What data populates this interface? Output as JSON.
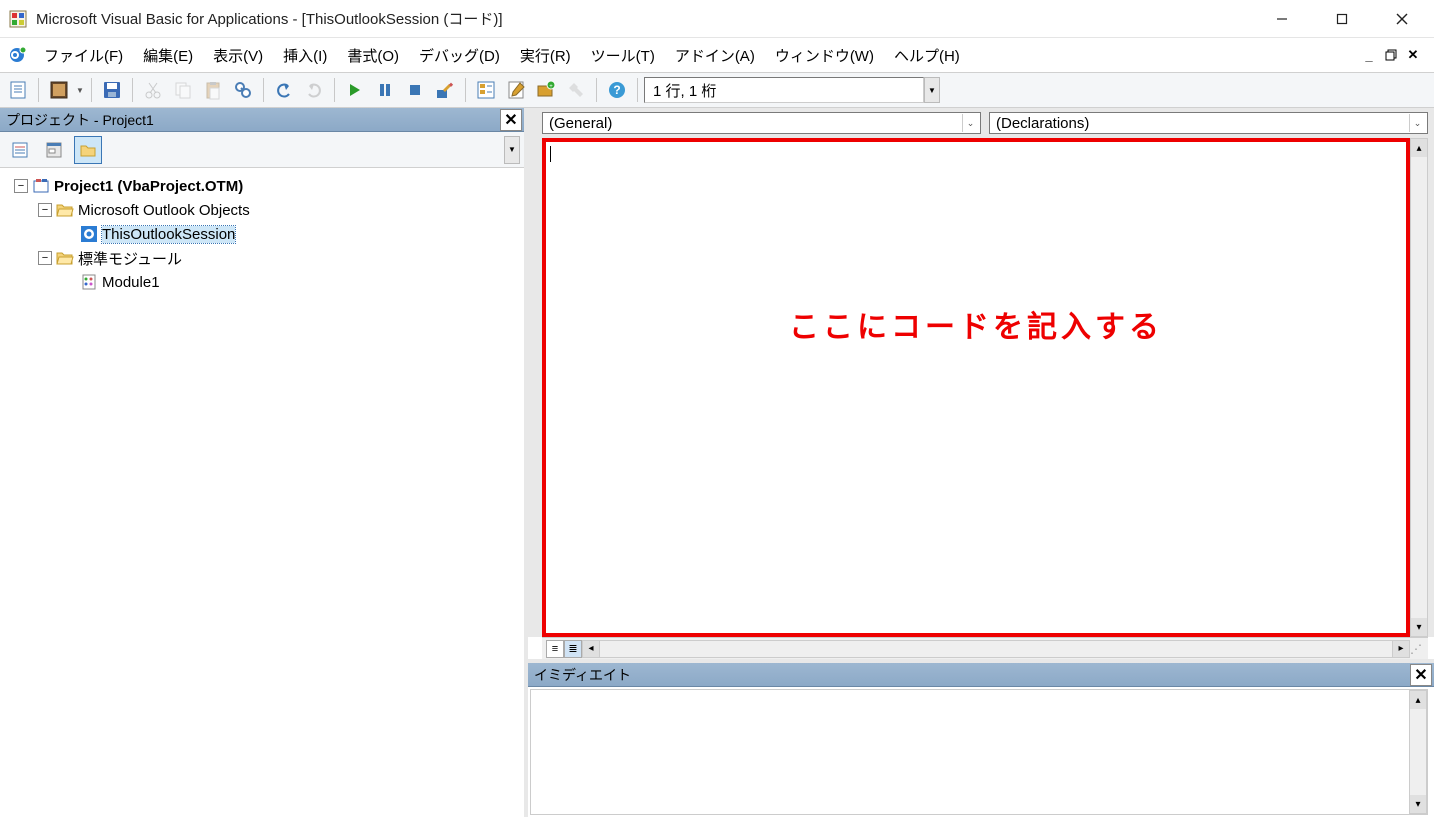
{
  "window": {
    "title": "Microsoft Visual Basic for Applications - [ThisOutlookSession (コード)]"
  },
  "menu": {
    "file": "ファイル(F)",
    "edit": "編集(E)",
    "view": "表示(V)",
    "insert": "挿入(I)",
    "format": "書式(O)",
    "debug": "デバッグ(D)",
    "run": "実行(R)",
    "tools": "ツール(T)",
    "addins": "アドイン(A)",
    "window": "ウィンドウ(W)",
    "help": "ヘルプ(H)"
  },
  "toolbar": {
    "position": "1 行, 1 桁"
  },
  "project_panel": {
    "title": "プロジェクト - Project1",
    "tree": {
      "root": "Project1 (VbaProject.OTM)",
      "folder1": "Microsoft Outlook Objects",
      "item1": "ThisOutlookSession",
      "folder2": "標準モジュール",
      "item2": "Module1"
    }
  },
  "code": {
    "object_dd": "(General)",
    "proc_dd": "(Declarations)",
    "annotation": "ここにコードを記入する"
  },
  "immediate": {
    "title": "イミディエイト"
  }
}
